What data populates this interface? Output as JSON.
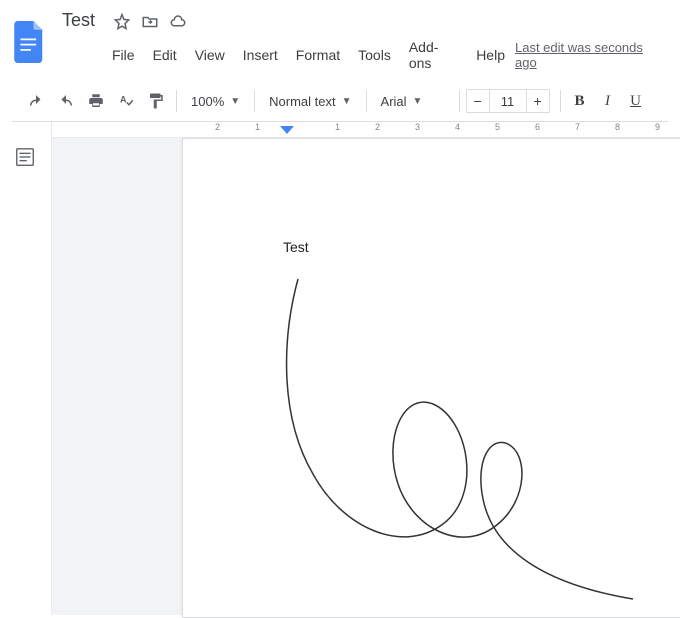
{
  "header": {
    "title": "Test",
    "last_edit": "Last edit was seconds ago"
  },
  "menubar": {
    "file": "File",
    "edit": "Edit",
    "view": "View",
    "insert": "Insert",
    "format": "Format",
    "tools": "Tools",
    "addons": "Add-ons",
    "help": "Help"
  },
  "toolbar": {
    "zoom": "100%",
    "style": "Normal text",
    "font": "Arial",
    "font_size": "11"
  },
  "ruler": {
    "ticks": [
      "2",
      "1",
      "",
      "1",
      "2",
      "3",
      "4",
      "5",
      "6",
      "7",
      "8",
      "9"
    ]
  },
  "document": {
    "text": "Test"
  }
}
